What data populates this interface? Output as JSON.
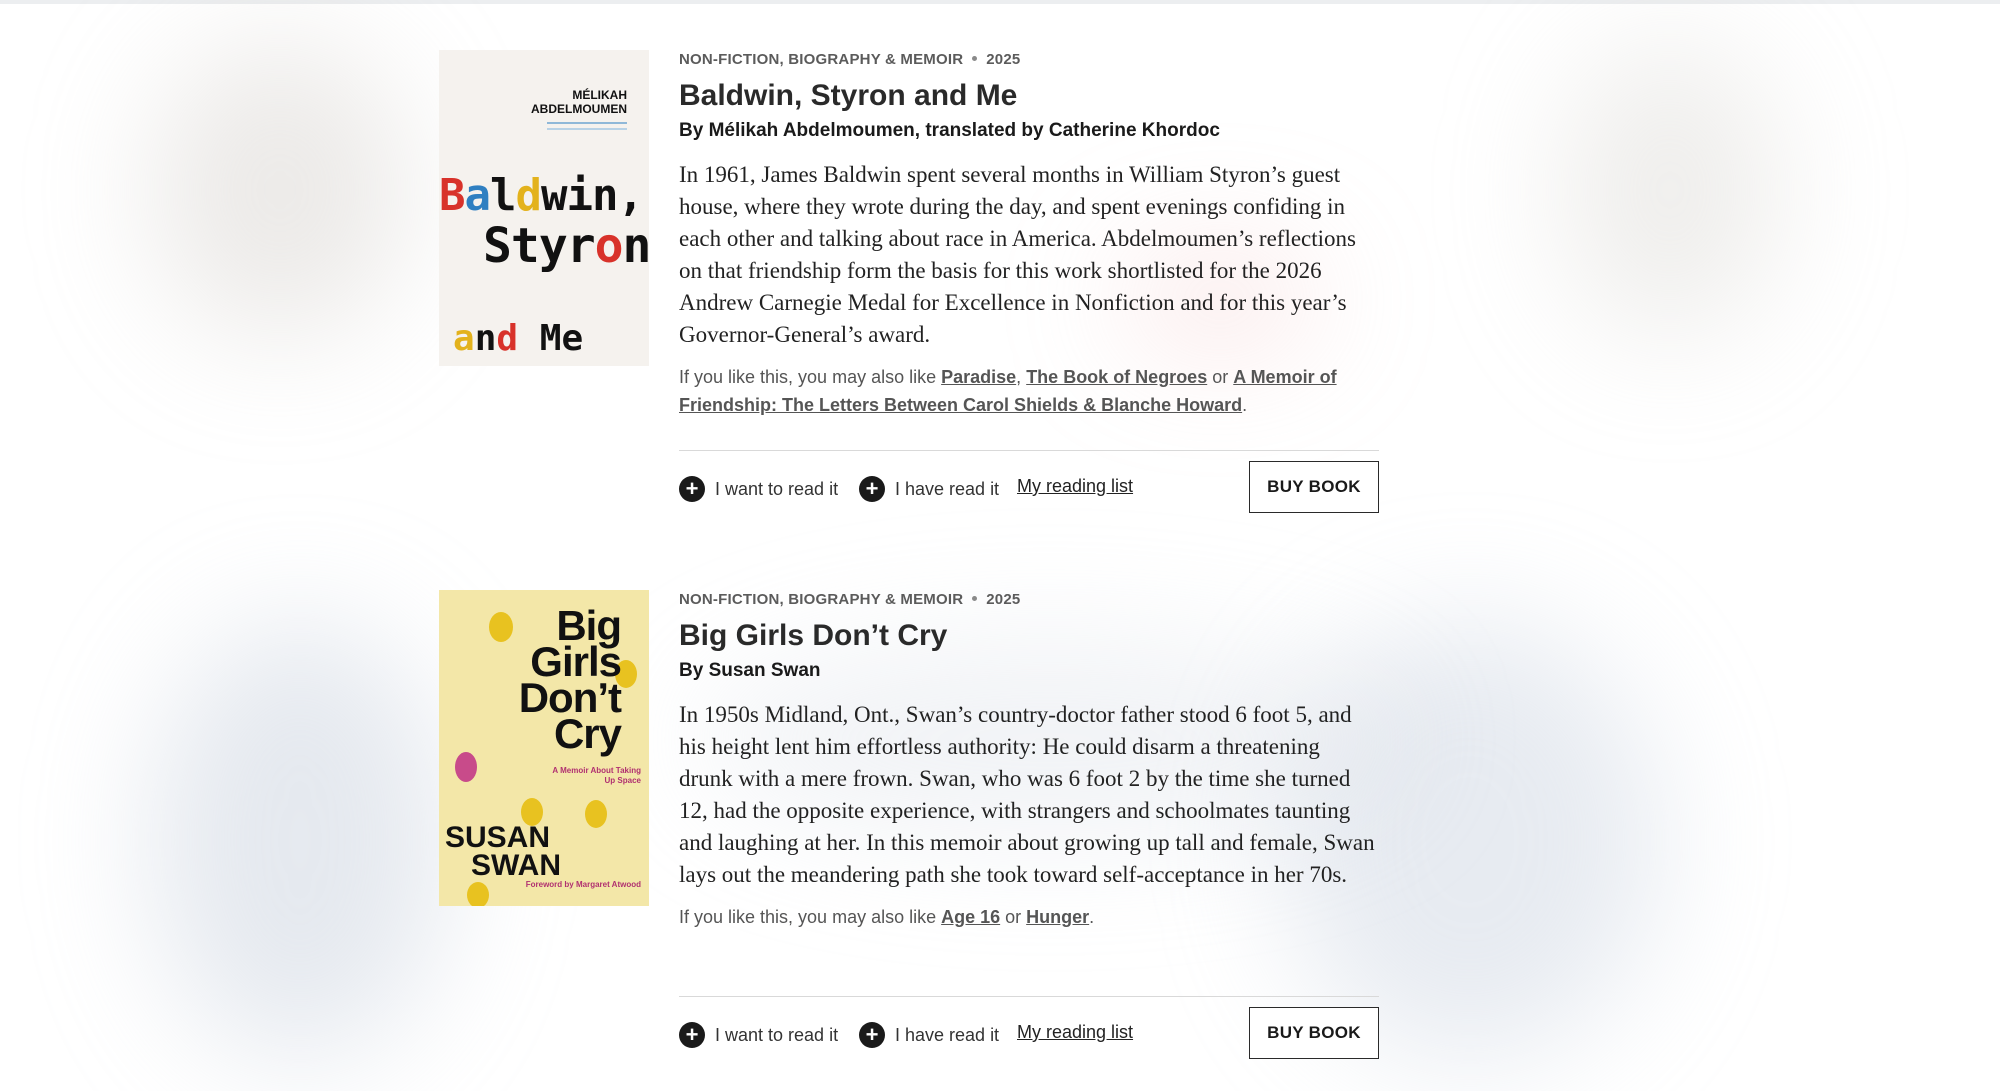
{
  "books": [
    {
      "category": "NON-FICTION, BIOGRAPHY & MEMOIR",
      "year": "2025",
      "title": "Baldwin, Styron and Me",
      "byline": "By Mélikah Abdelmoumen, translated by Catherine Khordoc",
      "description": "In 1961, James Baldwin spent several months in William Styron’s guest house, where they wrote during the day, and spent evenings confiding in each other and talking about race in America. Abdelmoumen’s reflections on that friendship form the basis for this work shortlisted for the 2026 Andrew Carnegie Medal for Excellence in Nonfiction and for this year’s Governor-General’s award.",
      "also_like_prefix": "If you like this, you may also like ",
      "also_like": [
        "Paradise",
        "The Book of Negroes",
        "A Memoir of Friendship: The Letters Between Carol Shields & Blanche Howard"
      ],
      "also_like_sep1": ", ",
      "also_like_sep2": " or ",
      "also_like_end": ".",
      "cover": {
        "author": "MÉLIKAH ABDELMOUMEN",
        "author_line1": "MÉLIKAH",
        "author_line2": "ABDELMOUMEN",
        "line1": "Baldwin,",
        "line2": "Styron",
        "line3": "and Me"
      }
    },
    {
      "category": "NON-FICTION, BIOGRAPHY & MEMOIR",
      "year": "2025",
      "title": "Big Girls Don’t Cry",
      "byline": "By Susan Swan",
      "description": "In 1950s Midland, Ont., Swan’s country-doctor father stood 6 foot 5, and his height lent him effortless authority: He could disarm a threatening drunk with a mere frown. Swan, who was 6 foot 2 by the time she turned 12, had the opposite experience, with strangers and schoolmates taunting and laughing at her. In this memoir about growing up tall and female, Swan lays out the meandering path she took toward self-acceptance in her 70s.",
      "also_like_prefix": "If you like this, you may also like ",
      "also_like": [
        "Age 16",
        "Hunger"
      ],
      "also_like_sep1": " or ",
      "also_like_end": ".",
      "cover": {
        "line1": "Big",
        "line2": "Girls",
        "line3": "Don’t",
        "line4": "Cry",
        "subtitle": "A Memoir About Taking Up Space",
        "author_line1": "SUSAN",
        "author_line2": "SWAN",
        "foreword": "Foreword by Margaret Atwood"
      }
    }
  ],
  "actions": {
    "want_to_read": "I want to read it",
    "have_read": "I have read it",
    "reading_list": "My reading list",
    "buy": "BUY BOOK"
  },
  "icons": {
    "add": "plus-circle-icon"
  },
  "colors": {
    "button_border": "#2a2a2a",
    "link": "#555555",
    "icon_bg": "#1a1a1a"
  }
}
